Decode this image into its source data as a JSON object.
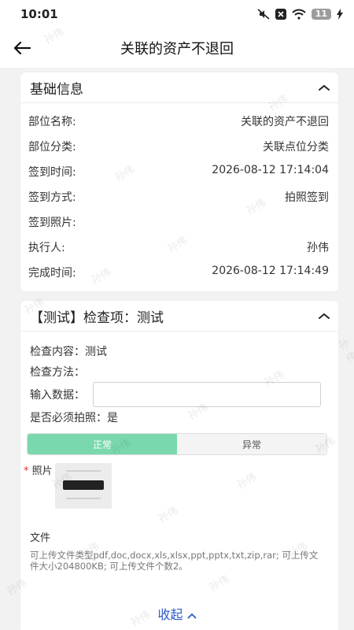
{
  "status_bar": {
    "time": "10:01",
    "battery": "11"
  },
  "header": {
    "title": "关联的资产不退回"
  },
  "basic": {
    "title": "基础信息",
    "rows": [
      {
        "label": "部位名称:",
        "value": "关联的资产不退回"
      },
      {
        "label": "部位分类:",
        "value": "关联点位分类"
      },
      {
        "label": "签到时间:",
        "value": "2026-08-12 17:14:04"
      },
      {
        "label": "签到方式:",
        "value": "拍照签到"
      },
      {
        "label": "签到照片:",
        "value": ""
      },
      {
        "label": "执行人:",
        "value": "孙伟"
      },
      {
        "label": "完成时间:",
        "value": "2026-08-12 17:14:49"
      }
    ]
  },
  "check": {
    "title": "【测试】检查项：测试",
    "content_label": "检查内容：",
    "content_value": "测试",
    "method_label": "检查方法：",
    "input_label": "输入数据：",
    "input_value": "",
    "photo_required_label": "是否必须拍照：",
    "photo_required_value": "是",
    "status_options": [
      "正常",
      "异常"
    ],
    "status_selected": "正常",
    "photo_label": "照片",
    "file_label": "文件",
    "file_hint": "可上传文件类型pdf,doc,docx,xls,xlsx,ppt,pptx,txt,zip,rar; 可上传文件大小204800KB; 可上传文件个数2。"
  },
  "collapse_label": "收起",
  "watermark": "孙伟",
  "colors": {
    "accent_green": "#7ad8ad",
    "link_blue": "#2b5cc8"
  }
}
